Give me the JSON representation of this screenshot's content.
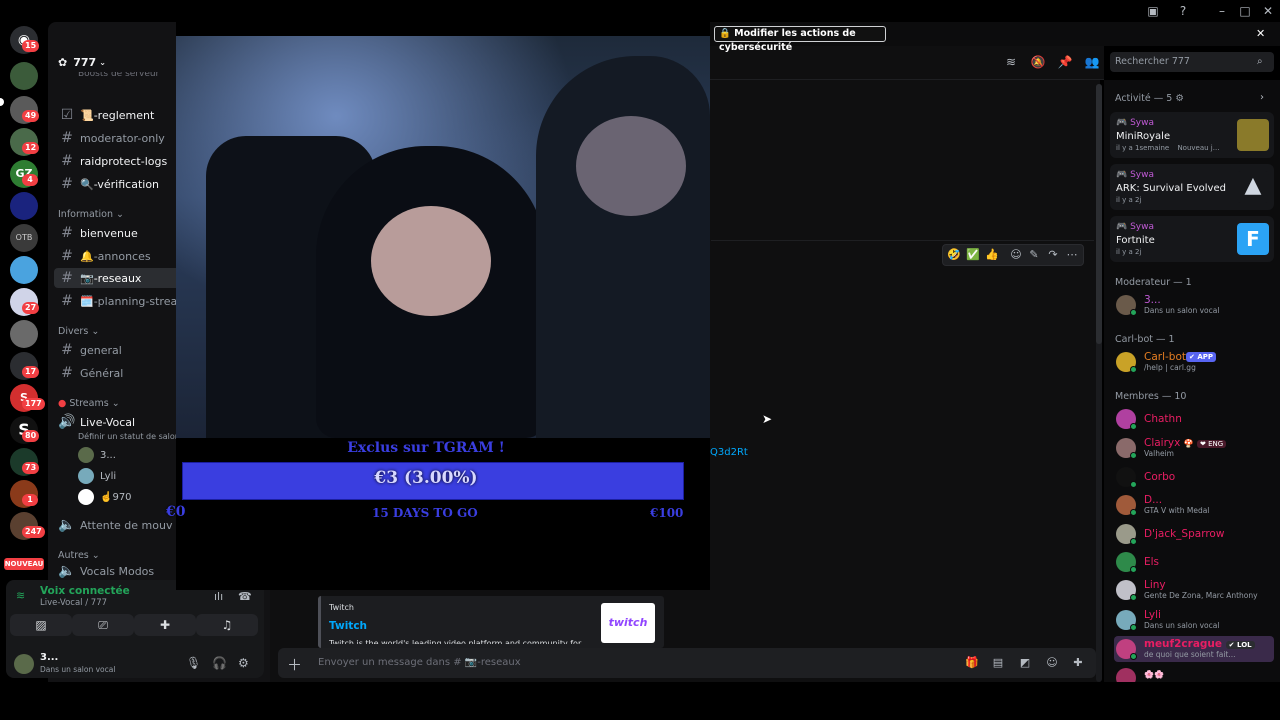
{
  "titlebar": {
    "icons": [
      "inbox-icon",
      "help-icon",
      "minimize-icon",
      "maximize-icon",
      "close-icon"
    ]
  },
  "rail": {
    "badges": [
      "15",
      "49",
      "12",
      "4",
      "27",
      "17",
      "177",
      "80",
      "73",
      "1",
      "247"
    ],
    "new_label": "NOUVEAU"
  },
  "guild": {
    "name": "777",
    "boost_text": "Boosts de serveur"
  },
  "channels": {
    "top": [
      "📜-reglement",
      "moderator-only",
      "raidprotect-logs",
      "🔍-vérification"
    ],
    "cat_information": "Information",
    "information": [
      "bienvenue",
      "🔔-annonces",
      "📷-reseaux",
      "🗓️-planning-streams"
    ],
    "cat_divers": "Divers",
    "divers": [
      "general",
      "Général"
    ],
    "cat_streams": "Streams",
    "live_vocal": "Live-Vocal",
    "live_status": "Définir un statut de salon",
    "voice_users": [
      "3...",
      "Lyli",
      "☝️970"
    ],
    "attente": "Attente de mouv",
    "cat_autres": "Autres",
    "vocals_modos": "Vocals Modos"
  },
  "voice_panel": {
    "status": "Voix connectée",
    "channel": "Live-Vocal / 777",
    "user_name": "3...",
    "user_status": "Dans un salon vocal"
  },
  "topstrip": {
    "security_button": "Modifier les actions de cybersécurité"
  },
  "search": {
    "placeholder": "Rechercher 777"
  },
  "stream": {
    "banner": "Exclus sur TGRAM !",
    "amount": "€3 (3.00%)",
    "min": "€0",
    "days": "15 DAYS TO GO",
    "max": "€100"
  },
  "message": {
    "link_fragment": "Q3d2Rt"
  },
  "embed": {
    "provider": "Twitch",
    "title": "Twitch",
    "desc": "Twitch is the world's leading video platform and community for gamers.",
    "thumb": "twitch"
  },
  "composer": {
    "placeholder": "Envoyer un message dans # 📷-reseaux"
  },
  "activity": {
    "header": "Activité — 5",
    "cards": [
      {
        "user": "Sywa",
        "game": "MiniRoyale",
        "meta": "il y a 1semaine",
        "extra": "Nouveau j..."
      },
      {
        "user": "Sywa",
        "game": "ARK: Survival Evolved",
        "meta": "il y a 2j",
        "extra": ""
      },
      {
        "user": "Sywa",
        "game": "Fortnite",
        "meta": "il y a 2j",
        "extra": ""
      }
    ]
  },
  "members": {
    "mod_header": "Moderateur — 1",
    "mods": [
      {
        "name": "3...",
        "sub": "Dans un salon vocal",
        "color": "#c15ad6"
      }
    ],
    "bot_header": "Carl-bot — 1",
    "bots": [
      {
        "name": "Carl-bot",
        "sub": "/help | carl.gg",
        "color": "#e67e22",
        "tag": "APP"
      }
    ],
    "members_header": "Membres — 10",
    "list": [
      {
        "name": "Chathn",
        "sub": "",
        "color": "#e91e63"
      },
      {
        "name": "Clairyx",
        "sub": "Valheim",
        "color": "#e91e63",
        "tag": "ENG"
      },
      {
        "name": "Corbo",
        "sub": "",
        "color": "#e91e63"
      },
      {
        "name": "D...",
        "sub": "GTA V with Medal",
        "color": "#e91e63"
      },
      {
        "name": "D'jack_Sparrow",
        "sub": "",
        "color": "#e91e63"
      },
      {
        "name": "Els",
        "sub": "",
        "color": "#e91e63"
      },
      {
        "name": "Liny",
        "sub": "Gente De Zona, Marc Anthony",
        "color": "#e91e63"
      },
      {
        "name": "Lyli",
        "sub": "Dans un salon vocal",
        "color": "#e91e63"
      },
      {
        "name": "meuf2crague",
        "sub": "de quoi que soient fait...",
        "color": "#e91e63",
        "tag": "LOL"
      },
      {
        "name": "🌸🌸",
        "sub": "",
        "color": "#e91e63"
      }
    ]
  }
}
